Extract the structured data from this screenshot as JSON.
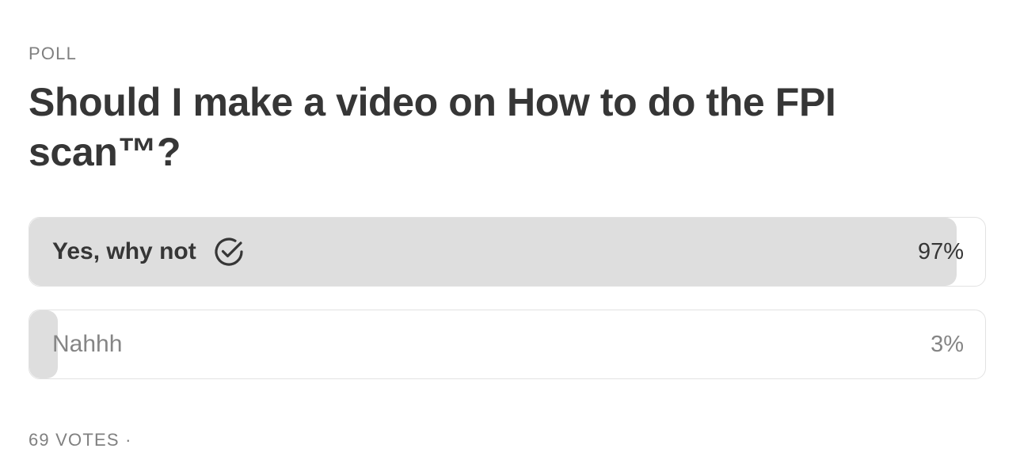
{
  "poll": {
    "kicker": "POLL",
    "question": "Should I make a video on How to do the FPI scan™?",
    "options": [
      {
        "label": "Yes, why not",
        "percent_text": "97%",
        "percent": 97,
        "selected": true,
        "icon": "checkmark-circle-icon"
      },
      {
        "label": "Nahhh",
        "percent_text": "3%",
        "percent": 3,
        "selected": false
      }
    ],
    "footer": "69 VOTES ·"
  },
  "colors": {
    "text": "#363636",
    "muted": "#808080",
    "fill": "#dedede",
    "border": "#e2e2e2"
  }
}
